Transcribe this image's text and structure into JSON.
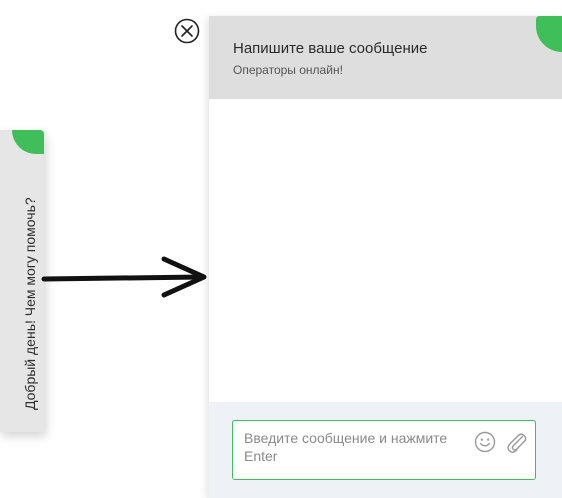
{
  "side_tab": {
    "label": "Добрый день! Чем могу помочь?"
  },
  "chat": {
    "title": "Напишите ваше сообщение",
    "subtitle": "Операторы онлайн!",
    "input": {
      "placeholder": "Введите сообщение и нажмите Enter",
      "value": ""
    }
  },
  "icons": {
    "close": "close-circle-icon",
    "emoji": "smiley-icon",
    "attach": "paperclip-icon",
    "arrow": "arrow-right-icon"
  },
  "colors": {
    "accent": "#3fbe5a",
    "header_bg": "#dedede",
    "footer_bg": "#eef1f5",
    "tab_bg": "#e6e6e6"
  }
}
